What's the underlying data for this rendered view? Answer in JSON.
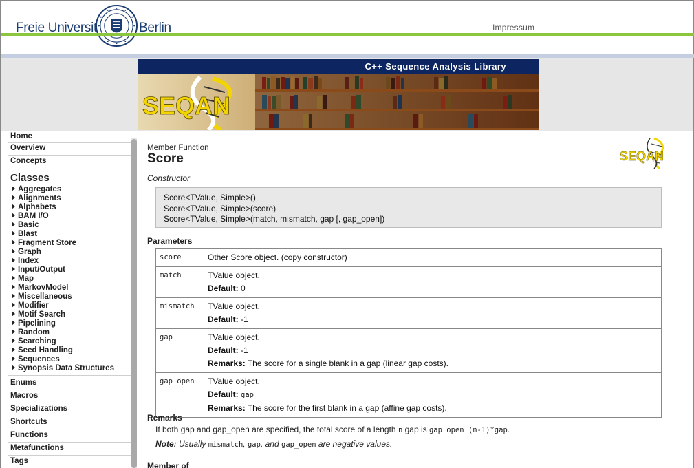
{
  "header": {
    "brand_left": "Freie Universität",
    "brand_right": "Berlin",
    "impressum": "Impressum"
  },
  "banner": {
    "title": "C++ Sequence Analysis Library",
    "logo_text": "SEQAN"
  },
  "sidebar": {
    "top_items": [
      "Home",
      "Overview",
      "Concepts"
    ],
    "classes_heading": "Classes",
    "classes": [
      "Aggregates",
      "Alignments",
      "Alphabets",
      "BAM I/O",
      "Basic",
      "Blast",
      "Fragment Store",
      "Graph",
      "Index",
      "Input/Output",
      "Map",
      "MarkovModel",
      "Miscellaneous",
      "Modifier",
      "Motif Search",
      "Pipelining",
      "Random",
      "Searching",
      "Seed Handling",
      "Sequences",
      "Synopsis Data Structures"
    ],
    "bottom_items": [
      "Enums",
      "Macros",
      "Specializations",
      "Shortcuts",
      "Functions",
      "Metafunctions",
      "Tags"
    ]
  },
  "main": {
    "kind": "Member Function",
    "title": "Score",
    "constructor_heading": "Constructor",
    "constructors": [
      "Score<TValue, Simple>()",
      "Score<TValue, Simple>(score)",
      "Score<TValue, Simple>(match, mismatch, gap [, gap_open])"
    ],
    "parameters_heading": "Parameters",
    "parameters": [
      {
        "name": "score",
        "desc": "Other Score object. (copy constructor)"
      },
      {
        "name": "match",
        "desc": "TValue object.",
        "default_label": "Default:",
        "default": "0"
      },
      {
        "name": "mismatch",
        "desc": "TValue object.",
        "default_label": "Default:",
        "default": "-1"
      },
      {
        "name": "gap",
        "desc": "TValue object.",
        "default_label": "Default:",
        "default": "-1",
        "remarks_label": "Remarks:",
        "remarks": "The score for a single blank in a gap (linear gap costs)."
      },
      {
        "name": "gap_open",
        "desc": "TValue object.",
        "default_label": "Default:",
        "default": "gap",
        "remarks_label": "Remarks:",
        "remarks": "The score for the first blank in a gap (affine gap costs)."
      }
    ],
    "remarks_heading": "Remarks",
    "remarks": {
      "p1": "If both gap and gap_open are specified, the total score of a length",
      "code1": "n",
      "p2": "gap is",
      "code2": "gap_open (n-1)*gap",
      "p3": "."
    },
    "note": {
      "label": "Note:",
      "p1": "Usually",
      "c1": "mismatch",
      "p2": ",",
      "c2": "gap",
      "p3": ", and",
      "c3": "gap_open",
      "p4": "are negative values."
    },
    "member_of_heading": "Member of"
  },
  "colors": {
    "fu_blue": "#1a3d73",
    "accent_green": "#8cc63f",
    "banner_navy": "#0d2560",
    "seqan_yellow": "#f2d500"
  }
}
